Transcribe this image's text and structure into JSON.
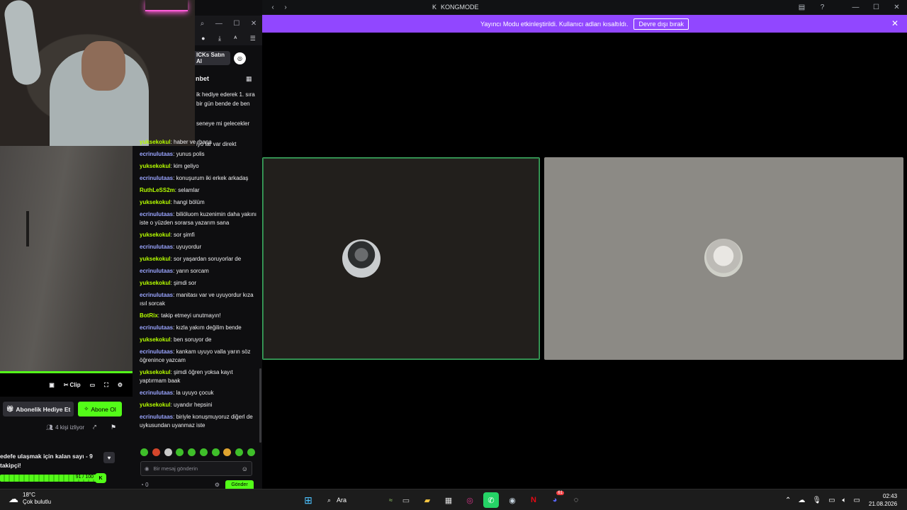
{
  "window": {
    "title": "KONGMODE",
    "title_glyph": "K"
  },
  "banner": {
    "message": "Yayıncı Modu etkinleştirildi. Kullanıcı adları kısaltıldı.",
    "button_label": "Devre dışı bırak"
  },
  "twitch": {
    "buy_label": "ICKs Satın Al",
    "chat_title_partial": "nbet",
    "truncated_lines": [
      "ik hediye ederek 1. sıra",
      "bir gün bende de ben",
      "seneye mi gelecekler",
      "iyo lar var direkt"
    ],
    "controls": {
      "clip_label": "Clip"
    },
    "subgift_label": "Abonelik Hediye Et",
    "follow_label": "Abone Ol",
    "viewers_text": "4 kişi izliyor",
    "goal_text": "edefe ulaşmak için kalan sayı - 9 takipçi!",
    "goal_progress": "91 / 100",
    "goal_fraction": 0.91,
    "chat_placeholder": "Bir mesaj gönderin",
    "chat_bottom_count": "0",
    "chat_send_label": "Gönder",
    "colors": {
      "accent": "#53fc18",
      "user_yellow": "#b6ff00",
      "user_blue": "#9aa5ff"
    },
    "messages": [
      {
        "user": "yuksekokul",
        "text": "haber ve rbana",
        "color": "#b6ff00"
      },
      {
        "user": "ecrinulutaas",
        "text": "yunus polis",
        "color": "#9aa5ff"
      },
      {
        "user": "yuksekokul",
        "text": "kim geliyo",
        "color": "#b6ff00"
      },
      {
        "user": "ecrinulutaas",
        "text": "konuşurum iki erkek arkadaş",
        "color": "#9aa5ff"
      },
      {
        "user": "RuthLeSS2m",
        "text": "selamlar",
        "color": "#b6ff00"
      },
      {
        "user": "yuksekokul",
        "text": "hangi bölüm",
        "color": "#b6ff00"
      },
      {
        "user": "ecrinulutaas",
        "text": "biliöluom kuzenimin daha yakını iste o yüzden sorarsa yazarım sana",
        "color": "#9aa5ff"
      },
      {
        "user": "yuksekokul",
        "text": "sor şimfi",
        "color": "#b6ff00"
      },
      {
        "user": "ecrinulutaas",
        "text": "uyuyordur",
        "color": "#9aa5ff"
      },
      {
        "user": "yuksekokul",
        "text": "sor yaşardan soruyorlar de",
        "color": "#b6ff00"
      },
      {
        "user": "ecrinulutaas",
        "text": "yarın sorcam",
        "color": "#9aa5ff"
      },
      {
        "user": "yuksekokul",
        "text": "şimdi sor",
        "color": "#b6ff00"
      },
      {
        "user": "ecrinulutaas",
        "text": "manitası var ve uyuyordur kıza ısıl sorcak",
        "color": "#9aa5ff"
      },
      {
        "user": "BotRix",
        "text": "takip etmeyi unutmayın!",
        "color": "#b6ff00"
      },
      {
        "user": "ecrinulutaas",
        "text": "kızla yakım değilim bende",
        "color": "#9aa5ff"
      },
      {
        "user": "yuksekokul",
        "text": "ben soruyor de",
        "color": "#b6ff00"
      },
      {
        "user": "ecrinulutaas",
        "text": "kankam uyuyo valla yarın söz öğrenince yazcam",
        "color": "#9aa5ff"
      },
      {
        "user": "yuksekokul",
        "text": "şimdi öğren yoksa kayıt yaptırmam baak",
        "color": "#b6ff00"
      },
      {
        "user": "ecrinulutaas",
        "text": "la uyuyo çocuk",
        "color": "#9aa5ff"
      },
      {
        "user": "yuksekokul",
        "text": "uyandır hepsini",
        "color": "#b6ff00"
      },
      {
        "user": "ecrinulutaas",
        "text": "biriyle konuşmuyoruz diğerl de uykusundan uyanmaz iste",
        "color": "#9aa5ff"
      }
    ]
  },
  "taskbar": {
    "weather_temp": "18°C",
    "weather_desc": "Çok bulutlu",
    "search_label": "Ara",
    "discord_badge": "61",
    "time": "02:43",
    "date": "21.08.2026"
  }
}
